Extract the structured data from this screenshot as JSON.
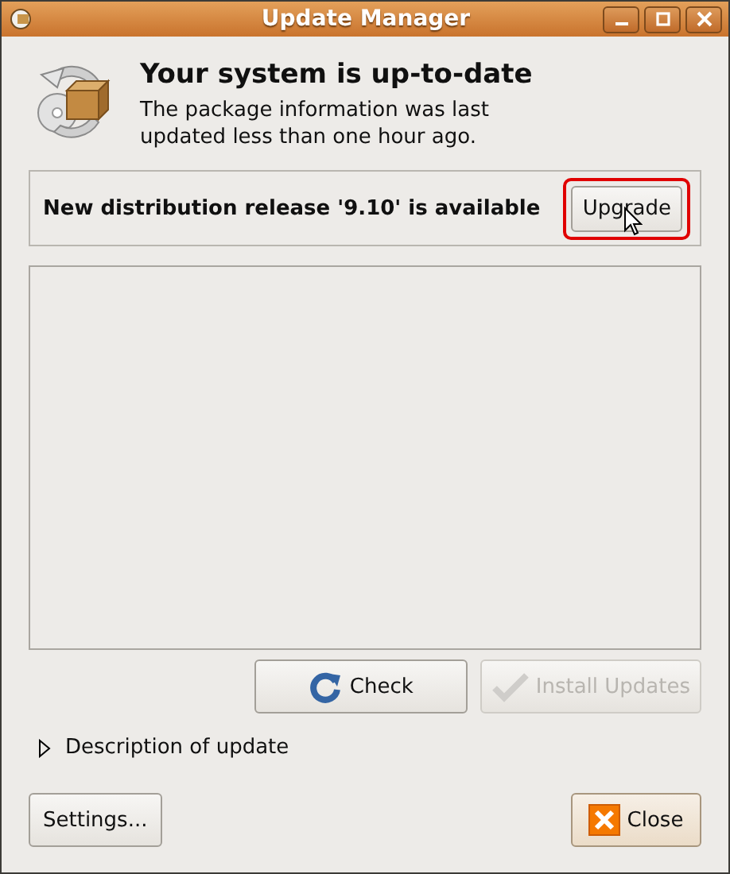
{
  "window": {
    "title": "Update Manager"
  },
  "header": {
    "title": "Your system is up-to-date",
    "message": "The package information was last updated less than one hour ago."
  },
  "release": {
    "text": "New distribution release '9.10' is available",
    "button": {
      "label": "Upgrade",
      "highlighted": true
    }
  },
  "actions": [
    {
      "kind": "check",
      "label": "Check",
      "disabled": false
    },
    {
      "kind": "install",
      "label": "Install Updates",
      "disabled": true
    }
  ],
  "description": {
    "label": "Description of update",
    "expanded": false
  },
  "footer": [
    {
      "kind": "settings",
      "label": "Settings..."
    },
    {
      "kind": "close",
      "label": "Close"
    }
  ]
}
